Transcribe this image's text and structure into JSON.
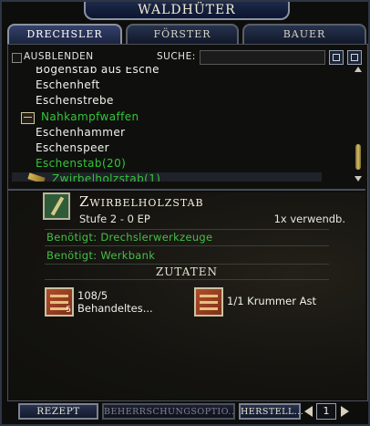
{
  "window": {
    "title": "Waldhüter"
  },
  "tabs": [
    {
      "label": "Drechsler",
      "active": true
    },
    {
      "label": "Förster",
      "active": false
    },
    {
      "label": "Bauer",
      "active": false
    }
  ],
  "filter": {
    "hide_label": "Ausblenden",
    "hide_checked": false,
    "search_label": "Suche:",
    "search_value": ""
  },
  "recipe_list": [
    {
      "label": "Bogenstab aus Esche",
      "type": "item",
      "color": "white"
    },
    {
      "label": "Eschenheft",
      "type": "item",
      "color": "white"
    },
    {
      "label": "Eschenstrebe",
      "type": "item",
      "color": "white"
    },
    {
      "label": "Nahkampfwaffen",
      "type": "category",
      "color": "green"
    },
    {
      "label": "Eschenhammer",
      "type": "item",
      "color": "white"
    },
    {
      "label": "Eschenspeer",
      "type": "item",
      "color": "white"
    },
    {
      "label": "Eschenstab(20)",
      "type": "item",
      "color": "green"
    },
    {
      "label": "Zwirbelholzstab(1)",
      "type": "item",
      "color": "green",
      "selected": true
    }
  ],
  "recipe": {
    "name": "Zwirbelholzstab",
    "stage": "Stufe 2 - 0 EP",
    "uses": "1x verwendb.",
    "requirements": [
      "Benötigt: Drechslerwerkzeuge",
      "Benötigt: Werkbank"
    ],
    "ingredients_header": "Zutaten",
    "ingredients": [
      {
        "line1": "108/5",
        "line2": "Behandeltes...",
        "badge": "5",
        "icon": "treated-wood-icon"
      },
      {
        "line1": "1/1 Krummer Ast",
        "line2": "",
        "badge": "",
        "icon": "crooked-branch-icon"
      }
    ]
  },
  "bottom": {
    "recipe_button": "Rezept",
    "mastery_button": "Beherrschungsoptio...",
    "craft_button": "Herstell...",
    "quantity": "1"
  },
  "colors": {
    "accent_green": "#35c43a",
    "frame_blue": "#1e2a48",
    "text_light": "#f2f2ec"
  }
}
